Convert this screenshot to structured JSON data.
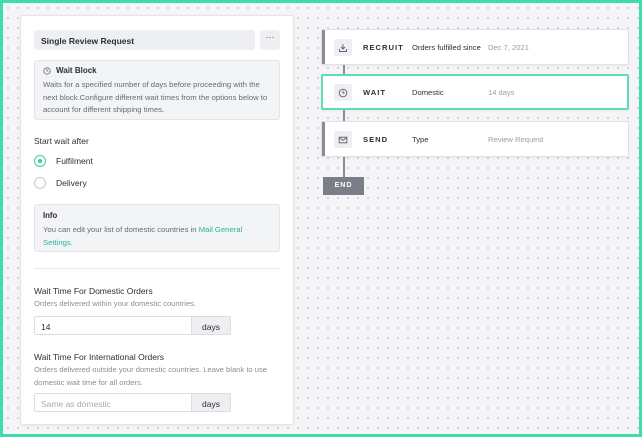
{
  "block": {
    "name": "Single Review Request",
    "more_label": "···"
  },
  "wait_info": {
    "title": "Wait Block",
    "description": "Waits for a specified number of days before proceeding with the next block.Configure different wait times from the options below to account for different shipping times."
  },
  "start_wait": {
    "label": "Start wait after",
    "options": [
      {
        "label": "Fulfilment",
        "checked": true
      },
      {
        "label": "Delivery",
        "checked": false
      }
    ]
  },
  "info": {
    "title": "Info",
    "text": "You can edit your list of domestic countries in ",
    "link": "Mail General Settings",
    "suffix": "."
  },
  "domestic": {
    "title": "Wait Time For Domestic Orders",
    "help": "Orders delivered within your domestic countries.",
    "value": "14",
    "unit": "days"
  },
  "international": {
    "title": "Wait Time For International Orders",
    "help": "Orders delivered outside your domestic countries. Leave blank to use domestic wait time for all orders.",
    "placeholder": "Same as domestic",
    "unit": "days"
  },
  "flow": {
    "steps": [
      {
        "type": "RECRUIT",
        "label": "Orders fulfilled since",
        "value": "Dec 7, 2021",
        "icon": "inbox-download-icon"
      },
      {
        "type": "WAIT",
        "label": "Domestic",
        "value": "14 days",
        "icon": "clock-icon"
      },
      {
        "type": "SEND",
        "label": "Type",
        "value": "Review Request",
        "icon": "envelope-icon"
      }
    ],
    "end_label": "END"
  },
  "colors": {
    "accent": "#3cc99d",
    "link": "#2bb39a",
    "frame_border": "#3fdcb0",
    "end_node": "#7b7e88"
  }
}
